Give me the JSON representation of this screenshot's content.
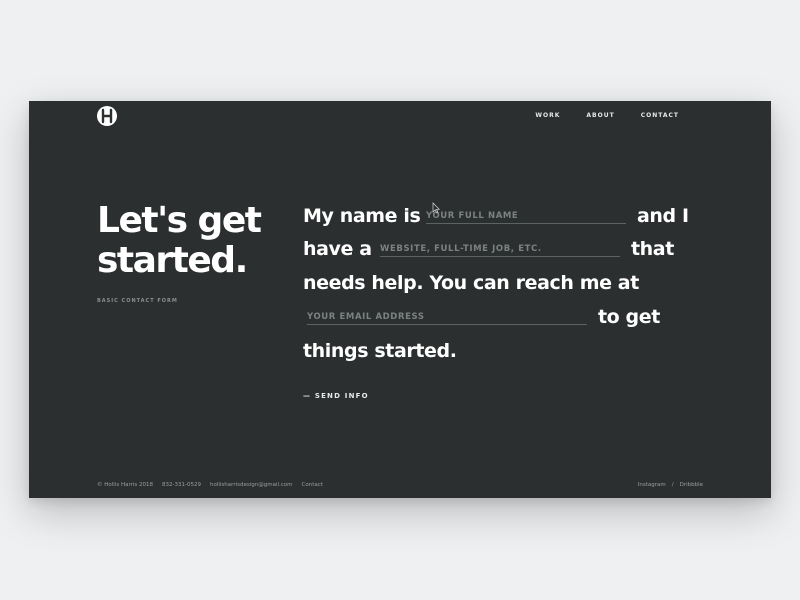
{
  "nav": {
    "items": [
      "WORK",
      "ABOUT",
      "CONTACT"
    ]
  },
  "hero": {
    "headline_line1": "Let's get",
    "headline_line2": "started.",
    "subhead": "BASIC CONTACT FORM"
  },
  "form": {
    "t1": "My name is",
    "name_placeholder": "YOUR FULL NAME",
    "t2": "and I",
    "t3": "have a",
    "project_placeholder": "WEBSITE, FULL-TIME JOB, ETC.",
    "t4": "that",
    "t5": "needs help. You can reach me at",
    "email_placeholder": "YOUR EMAIL ADDRESS",
    "t6": "to get",
    "t7": "things started.",
    "send_label": "— SEND INFO"
  },
  "footer": {
    "copyright": "© Hollis Harris 2018",
    "phone": "832-331-0529",
    "email": "hollisharrisdesign@gmail.com",
    "contact": "Contact",
    "instagram": "Instagram",
    "separator": "/",
    "dribbble": "Dribbble"
  },
  "colors": {
    "page_bg": "#eef0f2",
    "window_bg": "#2b2f2f",
    "text": "#ffffff",
    "muted": "#9a9e9e"
  }
}
